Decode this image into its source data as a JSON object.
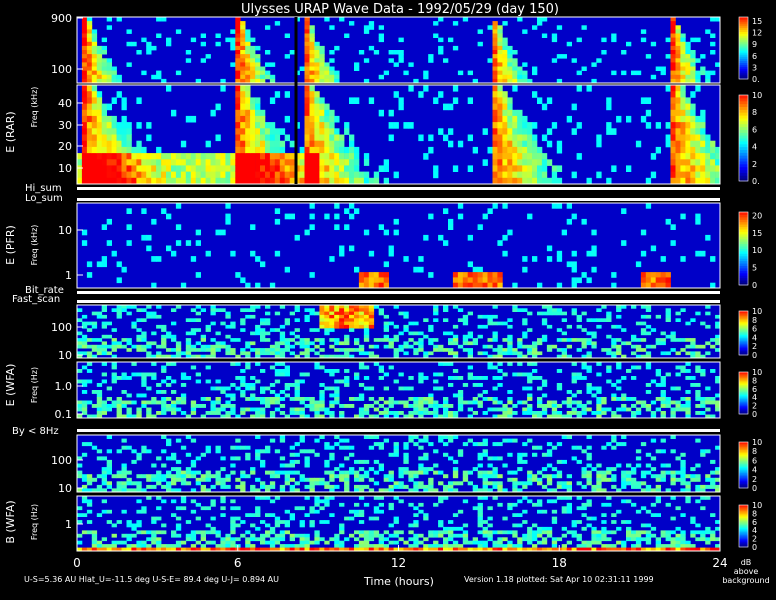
{
  "title": "Ulysses URAP Wave Data - 1992/05/29  (day 150)",
  "x_axis": {
    "label": "Time (hours)",
    "range": [
      0,
      24
    ],
    "ticks": [
      "0",
      "6",
      "12",
      "18",
      "24"
    ]
  },
  "footer": {
    "orbit": "U-S=5.36 AU   Hlat_U=-11.5 deg   U-S-E= 89.4 deg   U-J= 0.894 AU",
    "version": "Version 1.18 plotted: Sat Apr 10 02:31:11 1999"
  },
  "colorbar_unit": [
    "dB",
    "above",
    "background"
  ],
  "group_labels": {
    "e_rar": "E (RAR)",
    "e_pfr": "E (PFR)",
    "e_wfa": "E (WFA)",
    "b_wfa": "B (WFA)"
  },
  "freq_label": "Freq (kHz)",
  "freq_label_hz": "Freq (Hz)",
  "strip_labels": {
    "hi_sum": "Hi_sum",
    "lo_sum": "Lo_sum",
    "bit_rate": "Bit_rate",
    "fast_scan": "Fast_scan",
    "by": "By < 8Hz"
  },
  "colors": {
    "colormap": [
      "#000080",
      "#0000ff",
      "#0080ff",
      "#00ffff",
      "#80ff80",
      "#ffff00",
      "#ff8000",
      "#ff0000"
    ]
  },
  "chart_data": [
    {
      "type": "heatmap",
      "panel": "E (RAR) high",
      "ylabel": "",
      "y_ticks": [
        "100",
        "900"
      ],
      "colorbar_ticks": [
        "0.",
        "3",
        "6",
        "9",
        "12",
        "15"
      ],
      "colorbar_range": [
        0,
        16
      ],
      "features": [
        {
          "kind": "type III burst",
          "t_hours": 0.3
        },
        {
          "kind": "type III burst",
          "t_hours": 6.0
        },
        {
          "kind": "type III burst",
          "t_hours": 8.5
        },
        {
          "kind": "type III burst",
          "t_hours": 15.5
        },
        {
          "kind": "type III burst",
          "t_hours": 22.2
        }
      ]
    },
    {
      "type": "heatmap",
      "panel": "E (RAR) low",
      "ylabel": "Freq (kHz)",
      "y_ticks": [
        "10",
        "20",
        "30",
        "40"
      ],
      "colorbar_ticks": [
        "0.",
        "2",
        "4",
        "6",
        "8",
        "10"
      ],
      "colorbar_range": [
        0,
        10
      ]
    },
    {
      "type": "heatmap",
      "panel": "E (PFR)",
      "ylabel": "Freq (kHz)",
      "y_ticks": [
        "1",
        "10"
      ],
      "colorbar_ticks": [
        "0",
        "5",
        "10",
        "15",
        "20"
      ],
      "colorbar_range": [
        0,
        21
      ]
    },
    {
      "type": "heatmap",
      "panel": "E (WFA) high",
      "ylabel": "Freq (Hz)",
      "y_ticks": [
        "10",
        "100"
      ],
      "colorbar_ticks": [
        "0",
        "2",
        "4",
        "6",
        "8",
        "10"
      ],
      "colorbar_range": [
        0,
        10
      ]
    },
    {
      "type": "heatmap",
      "panel": "E (WFA) low",
      "ylabel": "Freq (Hz)",
      "y_ticks": [
        "0.1",
        "1.0"
      ],
      "colorbar_ticks": [
        "0",
        "2",
        "4",
        "6",
        "8",
        "10"
      ],
      "colorbar_range": [
        0,
        10
      ]
    },
    {
      "type": "heatmap",
      "panel": "B (WFA) high",
      "ylabel": "",
      "y_ticks": [
        "10",
        "100"
      ],
      "colorbar_ticks": [
        "0",
        "2",
        "4",
        "6",
        "8",
        "10"
      ],
      "colorbar_range": [
        0,
        10
      ]
    },
    {
      "type": "heatmap",
      "panel": "B (WFA) low",
      "ylabel": "Freq (Hz)",
      "y_ticks": [
        "1"
      ],
      "colorbar_ticks": [
        "0",
        "2",
        "4",
        "6",
        "8",
        "10"
      ],
      "colorbar_range": [
        0,
        10
      ]
    }
  ]
}
